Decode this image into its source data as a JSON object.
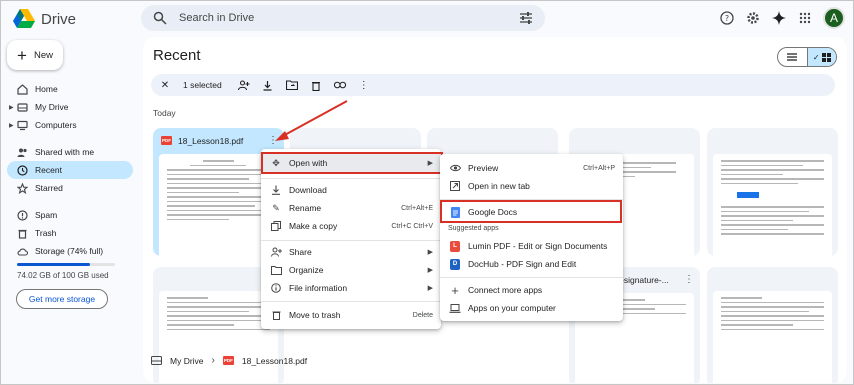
{
  "app": {
    "name": "Drive"
  },
  "search": {
    "placeholder": "Search in Drive"
  },
  "user": {
    "initial": "A"
  },
  "sidebar": {
    "new_label": "New",
    "items": [
      {
        "label": "Home",
        "icon": "home-icon"
      },
      {
        "label": "My Drive",
        "icon": "drive-icon"
      },
      {
        "label": "Computers",
        "icon": "computer-icon"
      },
      {
        "label": "Shared with me",
        "icon": "people-icon"
      },
      {
        "label": "Recent",
        "icon": "clock-icon"
      },
      {
        "label": "Starred",
        "icon": "star-icon"
      },
      {
        "label": "Spam",
        "icon": "spam-icon"
      },
      {
        "label": "Trash",
        "icon": "trash-icon"
      },
      {
        "label": "Storage (74% full)",
        "icon": "cloud-icon"
      }
    ],
    "storage_used_fraction": 0.74,
    "storage_text": "74.02 GB of 100 GB used",
    "get_storage_label": "Get more storage"
  },
  "main": {
    "title": "Recent",
    "selection_count": "1 selected",
    "section": "Today",
    "files": [
      {
        "name": "18_Lesson18.pdf"
      },
      {
        "name": "-signature-..."
      }
    ]
  },
  "breadcrumb": {
    "root": "My Drive",
    "file": "18_Lesson18.pdf"
  },
  "context_menu": {
    "open_with": "Open with",
    "download": "Download",
    "rename": "Rename",
    "rename_shortcut": "Ctrl+Alt+E",
    "make_copy": "Make a copy",
    "copy_shortcut": "Ctrl+C Ctrl+V",
    "share": "Share",
    "organize": "Organize",
    "file_info": "File information",
    "trash": "Move to trash",
    "trash_shortcut": "Delete"
  },
  "submenu": {
    "preview": "Preview",
    "preview_shortcut": "Ctrl+Alt+P",
    "new_tab": "Open in new tab",
    "google_docs": "Google Docs",
    "suggested_header": "Suggested apps",
    "lumin": "Lumin PDF - Edit or Sign Documents",
    "dochub": "DocHub - PDF Sign and Edit",
    "connect": "Connect more apps",
    "computer_apps": "Apps on your computer"
  },
  "colors": {
    "accent": "#0b57d0",
    "selected": "#c2e7ff",
    "highlight_box": "#d93025",
    "pdf_red": "#ea4335"
  }
}
